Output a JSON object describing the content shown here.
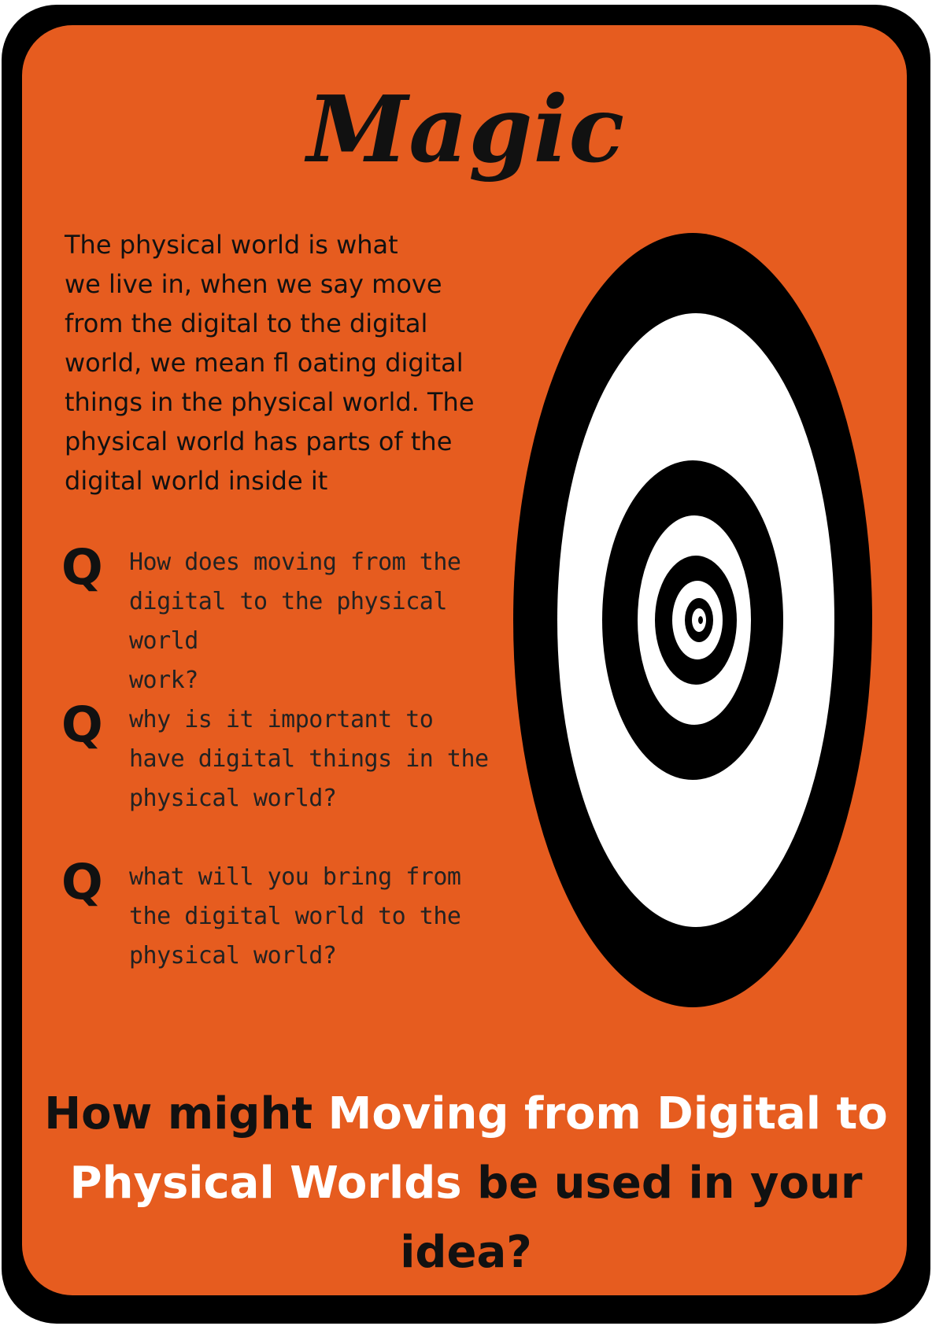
{
  "card": {
    "title": "Magic",
    "intro_lines": [
      "The physical world is what",
      "we live in, when we say move",
      "from the digital to the digital",
      "world, we mean fl oating digital",
      "things in the physical world. The",
      "physical world has parts of the",
      "digital world inside it"
    ],
    "question_marker": "Q",
    "questions": [
      {
        "lines": [
          "How does moving from the",
          "digital to the physical world",
          "work?"
        ]
      },
      {
        "lines": [
          "why is it important to",
          "have digital things in the",
          "physical world?"
        ]
      },
      {
        "lines": [
          "what will you bring from",
          "the digital world to the",
          "physical world?"
        ]
      }
    ],
    "prompt": {
      "part1": "How might ",
      "highlight1": "Moving from Digital to",
      "highlight2": "Physical Worlds",
      "part2": " be used in your idea?"
    },
    "illustration": "concentric-ellipse-target-icon",
    "colors": {
      "card_background": "#e65c1f",
      "frame": "#000000",
      "text_dark": "#111111",
      "highlight_text": "#ffffff"
    }
  }
}
